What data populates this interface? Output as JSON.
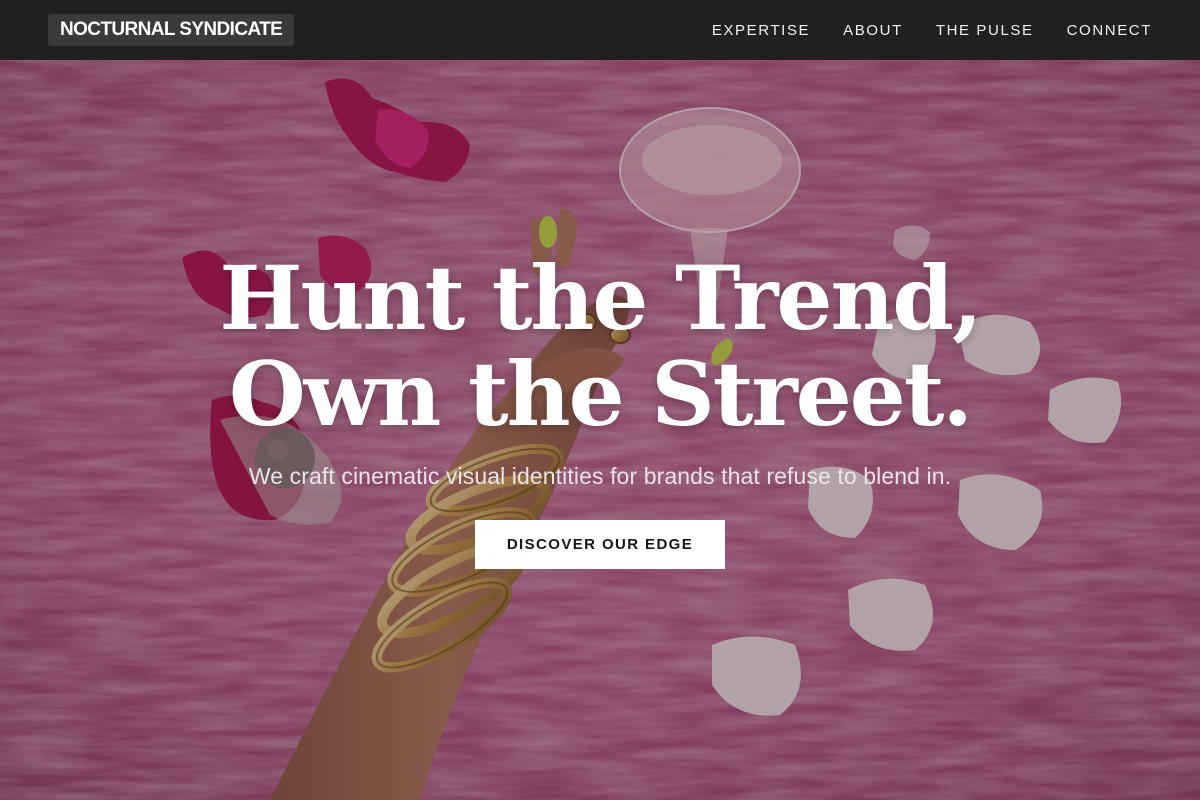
{
  "navbar": {
    "brand": "NOCTURNAL SYNDICATE",
    "links": [
      {
        "label": "EXPERTISE"
      },
      {
        "label": "ABOUT"
      },
      {
        "label": "THE PULSE"
      },
      {
        "label": "CONNECT"
      }
    ]
  },
  "hero": {
    "title_line1": "Hunt the Trend,",
    "title_line2": "Own the Street.",
    "subtitle": "We craft cinematic visual identities for brands that refuse to blend in.",
    "cta_label": "DISCOVER OUR EDGE"
  },
  "colors": {
    "navbar_bg": "#211f21",
    "brand_badge_bg": "#3b3a3b",
    "hero_backdrop_pink": "#b0567f",
    "cta_bg": "#ffffff",
    "cta_text": "#161616"
  }
}
